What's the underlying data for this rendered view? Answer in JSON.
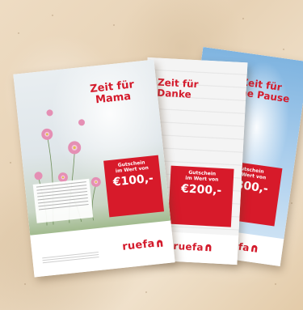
{
  "posters": [
    {
      "id": "pause",
      "title_line1": "Zeit für",
      "title_line2": "eine Pause",
      "voucher_label_line1": "Gutschein",
      "voucher_label_line2": "im Wert von",
      "voucher_amount": "€300,-",
      "logo": "ruefa"
    },
    {
      "id": "danke",
      "title_line1": "Zeit für",
      "title_line2": "Danke",
      "voucher_label_line1": "Gutschein",
      "voucher_label_line2": "im Wert von",
      "voucher_amount": "€200,-",
      "logo": "ruefa"
    },
    {
      "id": "mama",
      "title_line1": "Zeit für",
      "title_line2": "Mama",
      "voucher_label_line1": "Gutschein",
      "voucher_label_line2": "im Wert von",
      "voucher_amount": "€100,-",
      "logo": "ruefa"
    }
  ],
  "colors": {
    "brand_red": "#d71a2a",
    "sand": "#e9d6bb"
  }
}
